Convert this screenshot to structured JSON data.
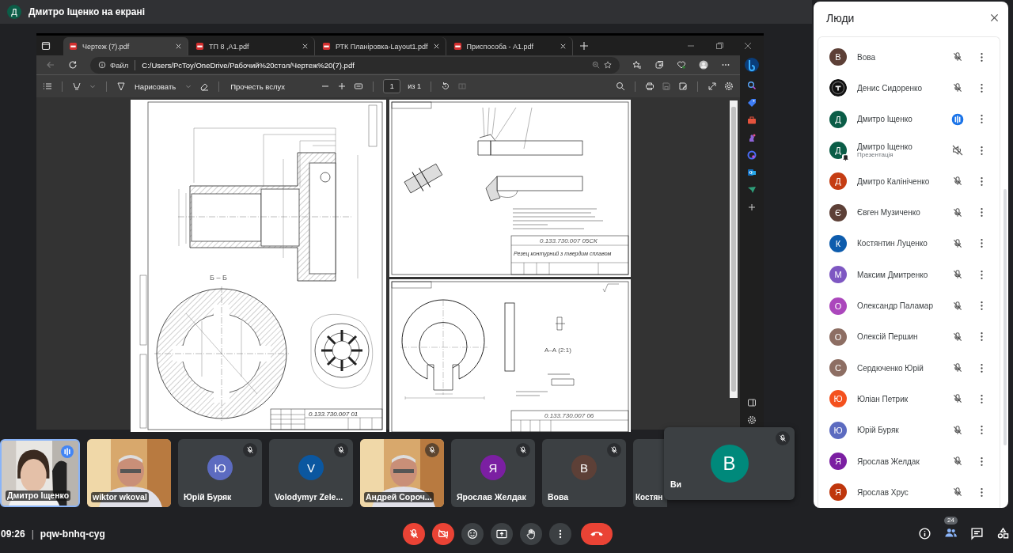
{
  "share_bar": {
    "avatar": {
      "letter": "Д",
      "color": "#0b5d47"
    },
    "title": "Дмитро Іщенко на екрані"
  },
  "browser": {
    "tabs": [
      {
        "title": "Чертеж (7).pdf",
        "selected": true
      },
      {
        "title": "ТП 8 ,А1.pdf",
        "selected": false
      },
      {
        "title": "РТК Планіровка-Layout1.pdf",
        "selected": false
      },
      {
        "title": "Приспособа - А1.pdf",
        "selected": false
      }
    ],
    "address": {
      "scheme": "Файл",
      "url": "C:/Users/PcToy/OneDrive/Рабочий%20стол/Чертеж%20(7).pdf"
    },
    "pdf_toolbar": {
      "draw": "Нарисовать",
      "read_aloud": "Прочесть вслух",
      "page": "1",
      "page_count": "из 1"
    },
    "sheets": [
      {
        "kind": "bushing",
        "code": "0.133.730.007 01",
        "view_label": "Б – Б"
      },
      {
        "kind": "cutter",
        "code": "0.133.730.007 05СК",
        "title": "Резец контурний з твердим сплавом"
      },
      {
        "kind": "ring",
        "code": "0.133.730.007 06",
        "view_label": "А–А (2:1)"
      }
    ]
  },
  "tiles": [
    {
      "name": "Дмитро Іщенко",
      "muted": false,
      "speaking": true,
      "selected": true
    },
    {
      "name": "wiktor wkoval",
      "muted": false,
      "speaking": false,
      "selected": false
    },
    {
      "name": "Юрій Буряк",
      "kind": "avatar",
      "letter": "Ю",
      "color": "#5c6bc0",
      "muted": true,
      "speaking": false,
      "selected": false
    },
    {
      "name": "Volodymyr Zele...",
      "kind": "avatar",
      "letter": "V",
      "color": "#0b57a0",
      "muted": true,
      "speaking": false,
      "selected": false
    },
    {
      "name": "Андрей Сороч...",
      "muted": true,
      "speaking": false,
      "selected": false
    },
    {
      "name": "Ярослав Желдак",
      "kind": "avatar",
      "letter": "Я",
      "color": "#7b1fa2",
      "muted": true,
      "speaking": false,
      "selected": false
    },
    {
      "name": "Вова",
      "kind": "avatar",
      "letter": "В",
      "color": "#5d4037",
      "muted": true,
      "speaking": false,
      "selected": false
    },
    {
      "name": "Костян",
      "kind": "covered",
      "muted": false,
      "speaking": false,
      "selected": false
    }
  ],
  "self_view": {
    "label": "Ви",
    "letter": "В",
    "color": "#00897b",
    "muted": true
  },
  "people": {
    "title": "Люди",
    "items": [
      {
        "name": "Вова",
        "kind": "letter",
        "letter": "В",
        "color": "#5d4037",
        "muted": true,
        "speaking": false,
        "sound_off": false
      },
      {
        "name": "Денис Сидоренко",
        "muted": true,
        "speaking": false,
        "sound_off": false
      },
      {
        "name": "Дмитро Іщенко",
        "kind": "letter",
        "letter": "Д",
        "color": "#0b5d47",
        "muted": false,
        "speaking": true,
        "sound_off": false
      },
      {
        "name": "Дмитро Іщенко",
        "subtitle": "Презентація",
        "kind": "letter",
        "letter": "Д",
        "color": "#0b5d47",
        "presenting": true,
        "muted": false,
        "speaking": false,
        "sound_off": true
      },
      {
        "name": "Дмитро Калініченко",
        "kind": "letter",
        "letter": "Д",
        "color": "#c53d13",
        "muted": true,
        "speaking": false,
        "sound_off": false
      },
      {
        "name": "Євген Музиченко",
        "kind": "letter",
        "letter": "Є",
        "color": "#5d4037",
        "muted": true,
        "speaking": false,
        "sound_off": false
      },
      {
        "name": "Костянтин Луценко",
        "kind": "letter",
        "letter": "К",
        "color": "#0d5cad",
        "muted": true,
        "speaking": false,
        "sound_off": false
      },
      {
        "name": "Максим Дмитренко",
        "kind": "letter",
        "letter": "М",
        "color": "#7e57c2",
        "muted": true,
        "speaking": false,
        "sound_off": false
      },
      {
        "name": "Олександр Паламар",
        "kind": "letter",
        "letter": "О",
        "color": "#ab47bc",
        "muted": true,
        "speaking": false,
        "sound_off": false
      },
      {
        "name": "Олексій Першин",
        "kind": "letter",
        "letter": "О",
        "color": "#8d6e63",
        "muted": true,
        "speaking": false,
        "sound_off": false
      },
      {
        "name": "Сердюченко Юрій",
        "kind": "letter",
        "letter": "С",
        "color": "#8d6e63",
        "muted": true,
        "speaking": false,
        "sound_off": false
      },
      {
        "name": "Юліан Петрик",
        "kind": "letter",
        "letter": "Ю",
        "color": "#f4511e",
        "muted": true,
        "speaking": false,
        "sound_off": false
      },
      {
        "name": "Юрій Буряк",
        "kind": "letter",
        "letter": "Ю",
        "color": "#5c6bc0",
        "muted": true,
        "speaking": false,
        "sound_off": false
      },
      {
        "name": "Ярослав Желдак",
        "kind": "letter",
        "letter": "Я",
        "color": "#7b1fa2",
        "muted": true,
        "speaking": false,
        "sound_off": false
      },
      {
        "name": "Ярослав Хрус",
        "kind": "letter",
        "letter": "Я",
        "color": "#bf360c",
        "muted": true,
        "speaking": false,
        "sound_off": false
      }
    ]
  },
  "meeting": {
    "time": "09:26",
    "separator": "|",
    "code": "pqw-bnhq-cyg",
    "mic_on": false,
    "camera_on": false,
    "people_count": "24",
    "people_open": true
  }
}
